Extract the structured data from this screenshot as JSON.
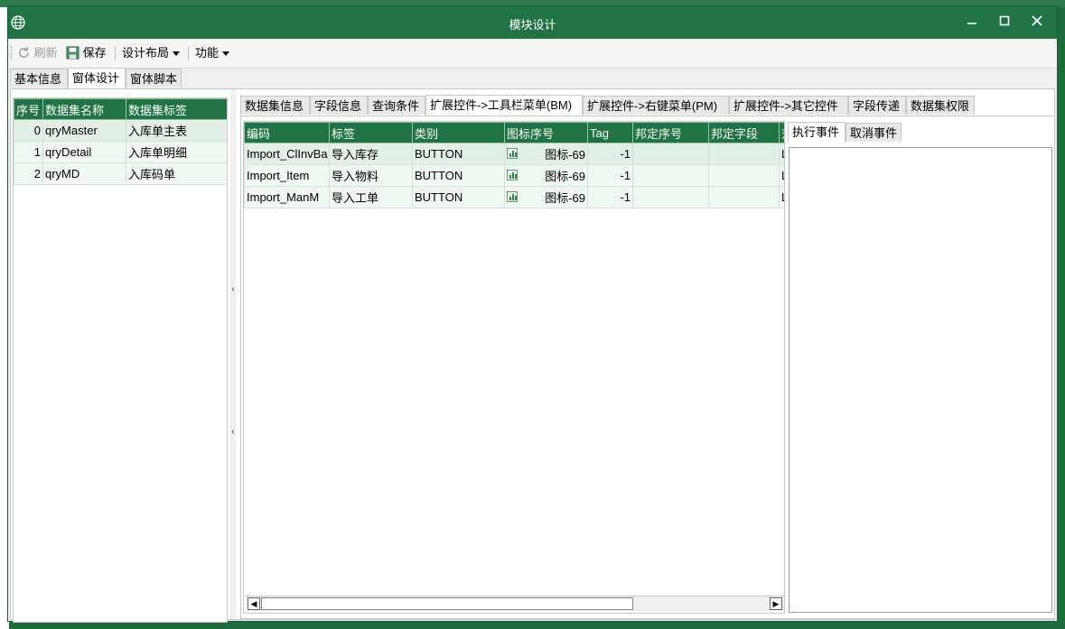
{
  "window": {
    "title": "模块设计"
  },
  "toolbar": {
    "refresh_label": "刷新",
    "save_label": "保存",
    "layout_label": "设计布局",
    "function_label": "功能"
  },
  "main_tabs": [
    {
      "label": "基本信息"
    },
    {
      "label": "窗体设计"
    },
    {
      "label": "窗体脚本"
    }
  ],
  "dataset_grid": {
    "headers": [
      "序号",
      "数据集名称",
      "数据集标签"
    ],
    "rows": [
      {
        "index": "0",
        "name": "qryMaster",
        "label": "入库单主表"
      },
      {
        "index": "1",
        "name": "qryDetail",
        "label": "入库单明细"
      },
      {
        "index": "2",
        "name": "qryMD",
        "label": "入库码单"
      }
    ]
  },
  "sub_tabs": [
    {
      "label": "数据集信息"
    },
    {
      "label": "字段信息"
    },
    {
      "label": "查询条件"
    },
    {
      "label": "扩展控件->工具栏菜单(BM)"
    },
    {
      "label": "扩展控件->右键菜单(PM)"
    },
    {
      "label": "扩展控件->其它控件"
    },
    {
      "label": "字段传递"
    },
    {
      "label": "数据集权限"
    }
  ],
  "bm_grid": {
    "headers": [
      "编码",
      "标签",
      "类别",
      "图标序号",
      "Tag",
      "邦定序号",
      "邦定字段",
      "对"
    ],
    "rows": [
      {
        "code": "Import_ClInvBa",
        "label": "导入库存",
        "type": "BUTTON",
        "icon": "图标-69",
        "tag": "-1",
        "bind_index": "",
        "bind_field": "",
        "extra": "L"
      },
      {
        "code": "Import_Item",
        "label": "导入物料",
        "type": "BUTTON",
        "icon": "图标-69",
        "tag": "-1",
        "bind_index": "",
        "bind_field": "",
        "extra": "L"
      },
      {
        "code": "Import_ManM",
        "label": "导入工单",
        "type": "BUTTON",
        "icon": "图标-69",
        "tag": "-1",
        "bind_index": "",
        "bind_field": "",
        "extra": "L"
      }
    ]
  },
  "event_tabs": [
    {
      "label": "执行事件"
    },
    {
      "label": "取消事件"
    }
  ],
  "colors": {
    "accent": "#217346",
    "titlebar": "#217346"
  }
}
